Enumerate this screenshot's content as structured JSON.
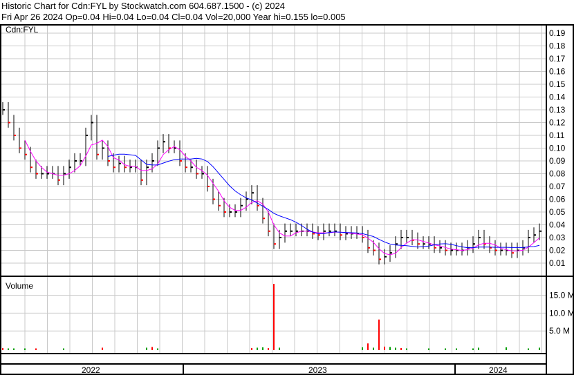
{
  "header": {
    "title": "Historic Chart for Cdn:FYL by Stockwatch.com 604.687.1500 - (c) 2024",
    "quote": "Fri Apr 26 2024  Op=0.04  Hi=0.04  Lo=0.04  Cl=0.04  Vol=20,000  Year hi=0.155  lo=0.005"
  },
  "chart_data": {
    "type": "line",
    "symbol_label": "Cdn:FYL",
    "volume_label": "Volume",
    "price_ticks": [
      "0.19",
      "0.18",
      "0.17",
      "0.16",
      "0.15",
      "0.14",
      "0.13",
      "0.12",
      "0.11",
      "0.10",
      "0.09",
      "0.08",
      "0.07",
      "0.06",
      "0.05",
      "0.04",
      "0.03",
      "0.02",
      "0.01"
    ],
    "volume_ticks": [
      "15.0 M",
      "10.0 M",
      "5.0 M"
    ],
    "years": [
      "2022",
      "2023",
      "2024"
    ],
    "ylim": [
      0,
      0.195
    ],
    "closes": [
      0.13,
      0.12,
      0.11,
      0.1,
      0.095,
      0.085,
      0.08,
      0.08,
      0.08,
      0.08,
      0.075,
      0.08,
      0.085,
      0.09,
      0.09,
      0.11,
      0.12,
      0.095,
      0.1,
      0.09,
      0.085,
      0.088,
      0.085,
      0.085,
      0.085,
      0.075,
      0.085,
      0.09,
      0.1,
      0.105,
      0.1,
      0.1,
      0.09,
      0.085,
      0.085,
      0.08,
      0.08,
      0.07,
      0.06,
      0.055,
      0.05,
      0.05,
      0.05,
      0.055,
      0.06,
      0.065,
      0.055,
      0.045,
      0.035,
      0.025,
      0.03,
      0.035,
      0.035,
      0.035,
      0.035,
      0.035,
      0.033,
      0.032,
      0.035,
      0.035,
      0.035,
      0.032,
      0.033,
      0.033,
      0.033,
      0.03,
      0.022,
      0.02,
      0.013,
      0.015,
      0.018,
      0.025,
      0.03,
      0.03,
      0.028,
      0.025,
      0.025,
      0.025,
      0.022,
      0.022,
      0.02,
      0.02,
      0.02,
      0.02,
      0.022,
      0.025,
      0.03,
      0.025,
      0.022,
      0.02,
      0.02,
      0.02,
      0.018,
      0.02,
      0.022,
      0.03,
      0.032,
      0.035
    ],
    "volume_m": [
      0.2,
      0.1,
      0.1,
      0,
      0.1,
      0,
      0.1,
      0,
      0,
      0,
      0,
      0.1,
      0,
      0,
      0,
      0,
      0,
      0,
      0.3,
      0,
      0,
      0,
      0,
      0,
      0,
      0,
      0.3,
      0.5,
      0.1,
      0,
      0,
      0,
      0,
      0,
      0,
      0,
      0,
      0,
      0,
      0,
      0,
      0,
      0,
      0,
      0,
      0.2,
      0.3,
      0.4,
      0.2,
      18.2,
      0.3,
      0,
      0,
      0,
      0,
      0,
      0,
      0,
      0,
      0,
      0,
      0,
      0,
      0,
      0,
      0.4,
      1.5,
      0.3,
      8.2,
      0.6,
      0.5,
      0.3,
      0.2,
      0.1,
      0,
      0,
      0,
      0.1,
      0,
      0,
      0.1,
      0,
      0.1,
      0,
      0,
      0.1,
      0.3,
      0,
      0,
      0,
      0,
      0.4,
      0,
      0,
      0,
      0.1,
      0,
      0.3
    ],
    "ma_colors": {
      "short": "#ff00ff",
      "long": "#0000ff"
    },
    "up_color": "#000000",
    "down_color": "#ff0000",
    "volume_color": "#ff0000"
  }
}
